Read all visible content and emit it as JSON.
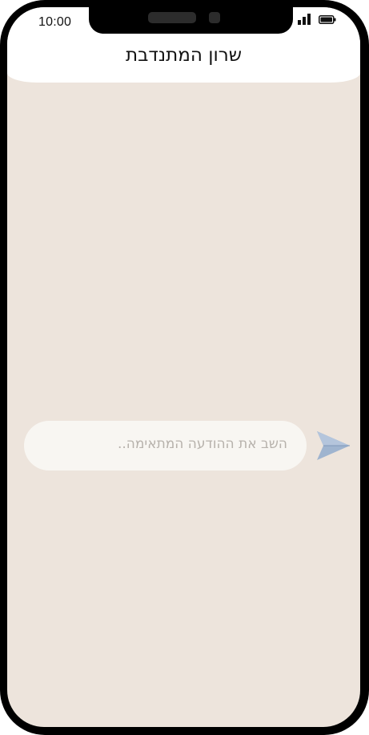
{
  "status_bar": {
    "time": "10:00",
    "signal_icon": "signal-bars-icon",
    "battery_icon": "battery-icon"
  },
  "chat": {
    "title": "שרון המתנדבת"
  },
  "composer": {
    "reply_text": "השב את ההודעה המתאימה..",
    "send_icon": "paper-plane-icon"
  },
  "colors": {
    "background": "#ede4dc",
    "header": "#ffffff",
    "input": "#f8f6f2",
    "placeholder": "#b7b2ac",
    "send_icon": "#9fb4cf",
    "frame": "#000000"
  }
}
